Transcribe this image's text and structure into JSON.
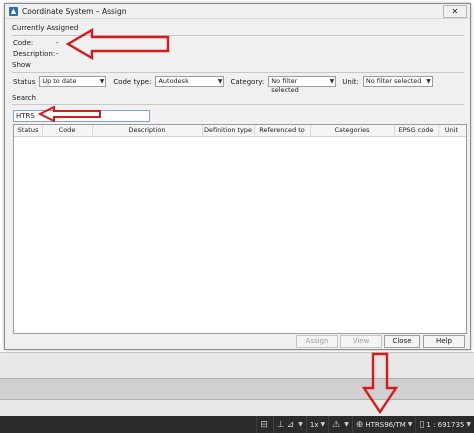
{
  "dialog": {
    "title": "Coordinate System – Assign",
    "close_glyph": "✕"
  },
  "assigned": {
    "section_label": "Currently Assigned",
    "code_label": "Code:",
    "code_value": "-",
    "description_label": "Description:",
    "description_value": "-"
  },
  "show": {
    "section_label": "Show",
    "status_label": "Status",
    "status_value": "Up to date",
    "code_type_label": "Code type:",
    "code_type_value": "Autodesk",
    "category_label": "Category:",
    "category_value": "No filter selected",
    "unit_label": "Unit:",
    "unit_value": "No filter selected"
  },
  "search": {
    "section_label": "Search",
    "value": "HTRS"
  },
  "table": {
    "columns": [
      "Status",
      "Code",
      "Description",
      "Definition type",
      "Referenced to",
      "Categories",
      "EPSG code",
      "Unit"
    ],
    "rows": []
  },
  "buttons": {
    "assign": "Assign",
    "view": "View",
    "close": "Close",
    "help": "Help"
  },
  "statusbar": {
    "scale_label": "1x",
    "coord_system": "HTRS96/TM",
    "scale_value": "1 : 691735"
  },
  "colors": {
    "annotation_arrow": "#d41b1b",
    "statusbar_bg": "#2b2b2b"
  }
}
